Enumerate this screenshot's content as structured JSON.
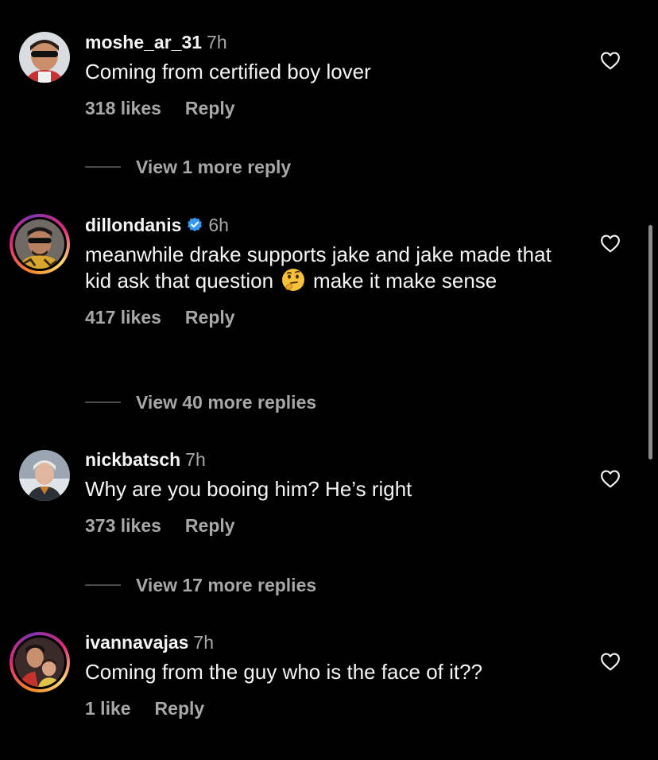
{
  "comments": [
    {
      "username": "moshe_ar_31",
      "time": "7h",
      "verified": false,
      "text": "Coming from certified boy lover",
      "likes": "318 likes",
      "reply": "Reply",
      "more": "View 1 more reply"
    },
    {
      "username": "dillondanis",
      "time": "6h",
      "verified": true,
      "text_part1": "meanwhile drake supports jake and jake made that kid ask that question",
      "emoji": "thinking-face",
      "text_part2": "make it make sense",
      "likes": "417 likes",
      "reply": "Reply",
      "more": "View 40 more replies"
    },
    {
      "username": "nickbatsch",
      "time": "7h",
      "verified": false,
      "text": "Why are you booing him? He’s right",
      "likes": "373 likes",
      "reply": "Reply",
      "more": "View 17 more replies"
    },
    {
      "username": "ivannavajas",
      "time": "7h",
      "verified": false,
      "text": "Coming from the guy who is the face of it??",
      "likes": "1 like",
      "reply": "Reply"
    }
  ],
  "colors": {
    "background": "#000000",
    "primary_text": "#f5f5f5",
    "secondary_text": "#a8a8a8",
    "verified_badge": "#3897f0",
    "story_ring_start": "#f58529",
    "story_ring_end": "#8134af"
  },
  "icons": {
    "like": "heart-outline-icon",
    "verified": "verified-badge-icon"
  }
}
